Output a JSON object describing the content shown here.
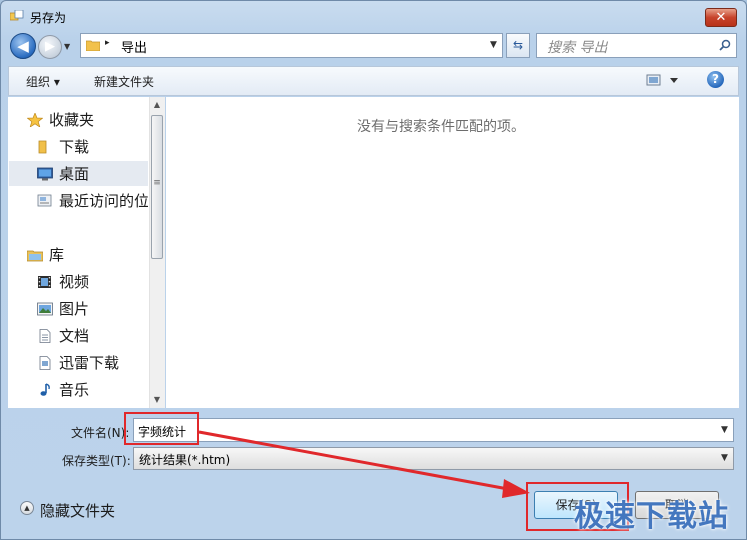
{
  "window": {
    "title": "另存为",
    "close_label": "✕"
  },
  "navigation": {
    "back_glyph": "◀",
    "forward_glyph": "▶",
    "history_glyph": "▼",
    "address_separator": "▸",
    "address": "导出",
    "address_dropdown": "▼",
    "refresh_glyph": "⇆",
    "search_placeholder": "搜索 导出"
  },
  "toolbar": {
    "organize_label": "组织 ▾",
    "new_folder_label": "新建文件夹",
    "help_label": "?"
  },
  "nav_pane": {
    "favorites": [
      {
        "label": "收藏夹",
        "icon": "star-icon"
      },
      {
        "label": "下载",
        "icon": "folder-icon"
      },
      {
        "label": "桌面",
        "icon": "desktop-icon"
      },
      {
        "label": "最近访问的位",
        "icon": "recent-places-icon"
      }
    ],
    "libraries": [
      {
        "label": "库",
        "icon": "library-icon"
      },
      {
        "label": "视频",
        "icon": "video-icon"
      },
      {
        "label": "图片",
        "icon": "pictures-icon"
      },
      {
        "label": "文档",
        "icon": "documents-icon"
      },
      {
        "label": "迅雷下载",
        "icon": "download-icon"
      },
      {
        "label": "音乐",
        "icon": "music-icon"
      }
    ],
    "scroll_up": "▲",
    "scroll_down": "▼",
    "scroll_grip": "≡"
  },
  "content": {
    "empty_message": "没有与搜索条件匹配的项。"
  },
  "form": {
    "filename_label": "文件名(N):",
    "filename_value": "字频统计",
    "filetype_label": "保存类型(T):",
    "filetype_value": "统计结果(*.htm)",
    "dropdown_glyph": "▼"
  },
  "footer": {
    "hide_folders_label": "隐藏文件夹",
    "hide_folders_glyph": "▲",
    "save_label": "保存(S)",
    "cancel_label": "取消"
  },
  "overlay": {
    "watermark": "极速下载站",
    "accent_color": "#e0282b"
  }
}
